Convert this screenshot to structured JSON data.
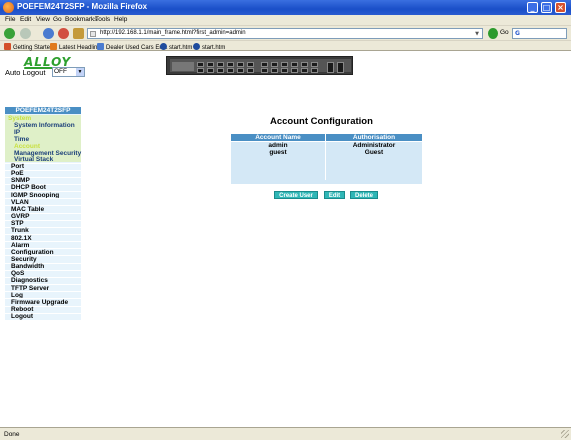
{
  "window": {
    "title": "POEFEM24T2SFP - Mozilla Firefox"
  },
  "menu": [
    "File",
    "Edit",
    "View",
    "Go",
    "Bookmarks",
    "Tools",
    "Help"
  ],
  "address_bar": {
    "url": "http://192.168.1.1/main_frame.html?first_admin=admin",
    "go_label": "Go",
    "search_icon": "google-icon"
  },
  "bookmarks": [
    {
      "label": "Getting Started",
      "icon": "firefox-icon",
      "color": "#d4502a"
    },
    {
      "label": "Latest Headlines",
      "icon": "rss-icon",
      "color": "#e07a1c"
    },
    {
      "label": "Dealer Used Cars En...",
      "icon": "page-icon",
      "color": "#4a7bd0"
    },
    {
      "label": "start.htm",
      "icon": "globe-icon",
      "color": "#1f4c9e"
    },
    {
      "label": "start.htm",
      "icon": "globe-icon",
      "color": "#1f4c9e"
    }
  ],
  "header": {
    "logo": "ALLOY",
    "auto_logout_label": "Auto Logout",
    "auto_logout_value": "OFF"
  },
  "sidebar": {
    "title": "POEFEM24T2SFP",
    "system_group": {
      "label": "System",
      "items": [
        "System Information",
        "IP",
        "Time",
        "Account",
        "Management Security",
        "Virtual Stack"
      ],
      "active": "Account"
    },
    "items": [
      "Port",
      "PoE",
      "SNMP",
      "DHCP Boot",
      "IGMP Snooping",
      "VLAN",
      "MAC Table",
      "GVRP",
      "STP",
      "Trunk",
      "802.1X",
      "Alarm",
      "Configuration",
      "Security",
      "Bandwidth",
      "QoS",
      "Diagnostics",
      "TFTP Server",
      "Log",
      "Firmware Upgrade",
      "Reboot",
      "Logout"
    ]
  },
  "main": {
    "title": "Account Configuration",
    "table": {
      "headers": [
        "Account Name",
        "Authorisation"
      ],
      "rows": [
        [
          "admin",
          "Administrator"
        ],
        [
          "guest",
          "Guest"
        ]
      ]
    },
    "buttons": {
      "create": "Create User",
      "edit": "Edit",
      "delete": "Delete"
    }
  },
  "status": {
    "text": "Done"
  },
  "colors": {
    "accent": "#4a8fc4",
    "button": "#2fb6b6",
    "sidebar_bg": "#e8f4fc",
    "system_group_bg": "#dff0c8",
    "logo": "#2ea02e"
  }
}
